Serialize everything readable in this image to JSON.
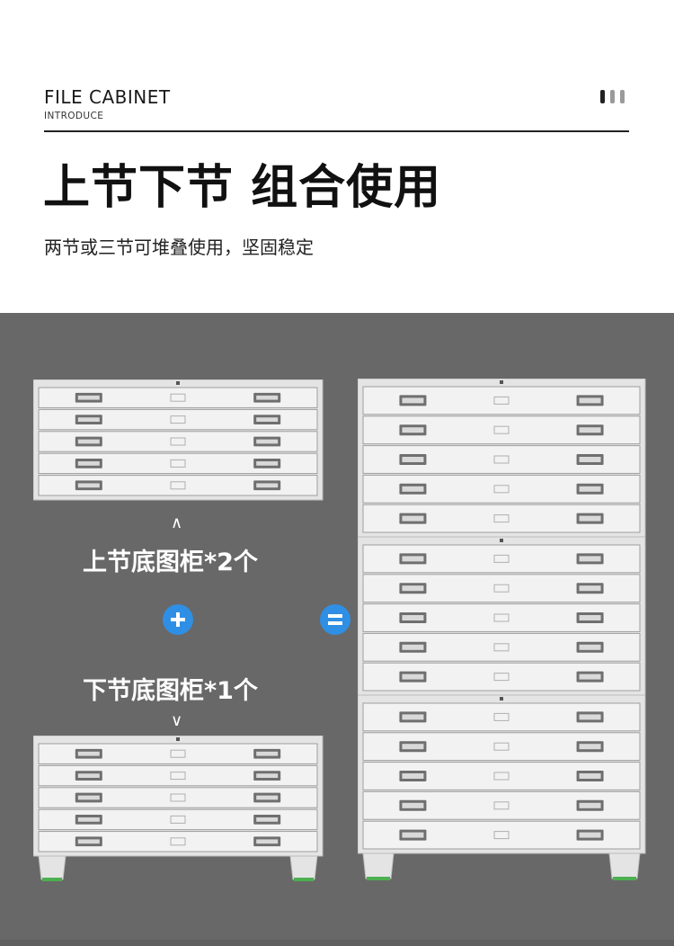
{
  "header": {
    "title_en": "FILE CABINET",
    "subtitle_en": "INTRODUCE",
    "title_cn": "上节下节 组合使用",
    "subtitle_cn": "两节或三节可堆叠使用，坚固稳定"
  },
  "comparison": {
    "top_label": "上节底图柜*2个",
    "bottom_label": "下节底图柜*1个",
    "up_arrow": "∧",
    "down_arrow": "∨",
    "plus_symbol": "plus",
    "equals_symbol": "equals"
  },
  "colors": {
    "panel_bg": "#686868",
    "cabinet_body": "#e4e4e4",
    "drawer_face": "#f2f2f2",
    "accent_blue": "#2f8fe4",
    "bar_dark": "#222222",
    "bar_light": "#9a9a9a"
  },
  "icons": [
    "bars-icon",
    "plus-icon",
    "equals-icon"
  ]
}
